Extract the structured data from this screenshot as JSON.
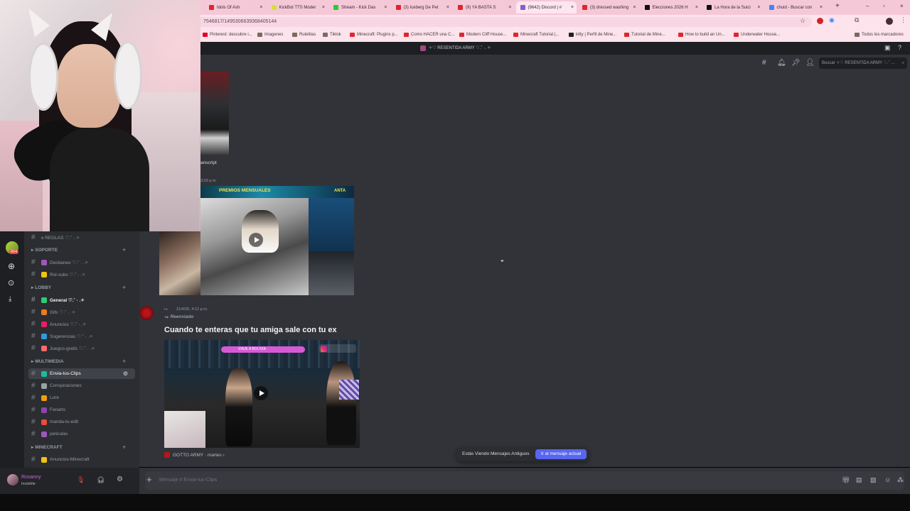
{
  "browser": {
    "tabs": [
      {
        "label": "Idols Of Ash",
        "color": "#e0262c"
      },
      {
        "label": "KickBot TTS Moder",
        "color": "#d6e03b"
      },
      {
        "label": "Stream - Kick Das",
        "color": "#31c734"
      },
      {
        "label": "(3) Iceberg De Pet",
        "color": "#e0262c"
      },
      {
        "label": "(9) YA BASTA S",
        "color": "#e0262c"
      },
      {
        "label": "(9642) Discord | #",
        "color": "#8a5cc7"
      },
      {
        "label": "(3) dressed washing",
        "color": "#e0262c"
      },
      {
        "label": "Elecciones 2026 H",
        "color": "#111111"
      },
      {
        "label": "La Hora de la Suici",
        "color": "#111111"
      },
      {
        "label": "chuid - Buscar con",
        "color": "#4285f4"
      }
    ],
    "url": "7546817/1495306639368405144",
    "bookmarks": [
      "Pinterest: descubre i...",
      "Imagenes",
      "Ruletitas",
      "Tiktok",
      "Minecraft: Plugins p...",
      "Como HACER una C...",
      "Modern Cliff House...",
      "Minecraft Tutorial |...",
      "kitty | Perfil de Mine...",
      "Tutorial de Mine...",
      "How to build an Un...",
      "Underwater House...",
      "Todos los marcadores"
    ]
  },
  "discord": {
    "window_title": "✧♡ RESENTIDA ARMY ♡.˚ ·. ✧",
    "search_placeholder": "Buscar ✧♡ RESENTIDA ARMY ♡.˚ ...",
    "notification_badge": "604",
    "sidebar": {
      "top_partial": "ʚ REGLAS ♡.˚ ·.✧",
      "categories": [
        {
          "name": "SOPORTE",
          "channels": [
            "Desbaneo ♡.˚ · .✧",
            "Rol-subs ♡.˚ · .✧"
          ]
        },
        {
          "name": "LOBBY",
          "channels": [
            "General ♡.˚ · .✧",
            "Gifs ♡.˚ · .✧",
            "Anuncios ♡.˚ · .✧",
            "Sugerencias ♡.˚ · .✧",
            "Juegos-gratis ♡.˚ · .✧"
          ]
        },
        {
          "name": "MULTIMEDIA",
          "channels": [
            "Envia-tus-Clips",
            "Conspiraciones",
            "Lore",
            "Fanarts",
            "manda-tu-edit",
            "peliculas"
          ]
        },
        {
          "name": "MINECRAFT",
          "channels": [
            "Anuncios-Minecraft"
          ]
        }
      ]
    },
    "messages": {
      "partial_text": "anscript",
      "partial_time": "3:03 p.m.",
      "video1_banner": "PREMIOS MENSUALES",
      "video1_banner2": "ANTA",
      "msg2_time": "21/4/26, 4:12 p.m.",
      "msg2_forwarded": "Reenviado",
      "msg2_text": "Cuando te enteras que tu amiga sale con tu ex",
      "video2_caption": "VIAJE A BOLIVIA",
      "video2_footer": "GOTTO ARMY · martes ›"
    },
    "jump_bar": {
      "text": "Estás Viendo Mensajes Antiguos",
      "button": "Ir al mensaje actual"
    },
    "composer_placeholder": "Mensaje # Envia-tus-Clips",
    "user": {
      "name": "Roxanny",
      "status": "Invisible"
    }
  },
  "colors": {
    "accent": "#5865f2",
    "bg": "#313338",
    "sidebar": "#2b2d31"
  }
}
